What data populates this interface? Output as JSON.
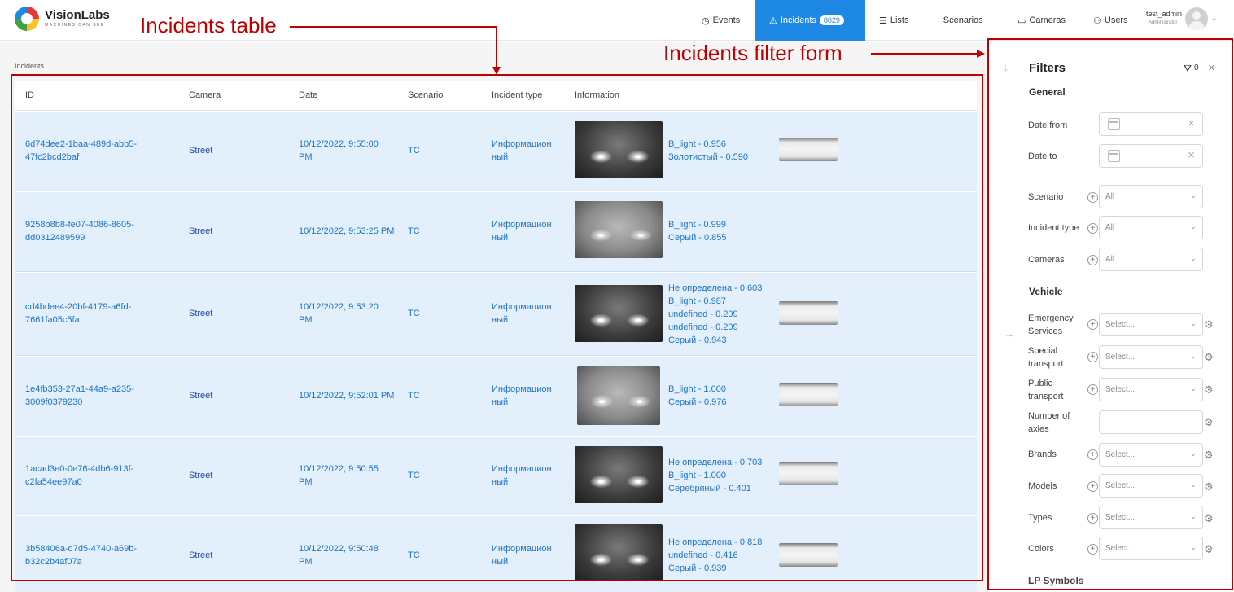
{
  "app": {
    "logo_title": "VisionLabs",
    "logo_sub": "MACHINES CAN SEE"
  },
  "nav": {
    "events": "Events",
    "incidents": "Incidents",
    "incidents_count": "8029",
    "lists": "Lists",
    "scenarios": "Scenarios",
    "cameras": "Cameras",
    "users": "Users"
  },
  "user": {
    "name": "test_admin",
    "role": "Administrator"
  },
  "page": {
    "breadcrumb": "Incidents"
  },
  "table": {
    "headers": {
      "id": "ID",
      "camera": "Camera",
      "date": "Date",
      "scenario": "Scenario",
      "type": "Incident type",
      "info": "Information"
    },
    "rows": [
      {
        "id1": "6d74dee2-1baa-489d-abb5-",
        "id2": "47fc2bcd2baf",
        "camera": "Street",
        "date1": "10/12/2022, 9:55:00",
        "date2": "PM",
        "scenario": "TC",
        "type1": "Информацион",
        "type2": "ный",
        "info": [
          "B_light - 0.956",
          "Золотистый - 0.590"
        ]
      },
      {
        "id1": "9258b8b8-fe07-4086-8605-",
        "id2": "dd0312489599",
        "camera": "Street",
        "date1": "10/12/2022, 9:53:25 PM",
        "date2": "",
        "scenario": "TC",
        "type1": "Информацион",
        "type2": "ный",
        "info": [
          "B_light - 0.999",
          "Серый - 0.855"
        ]
      },
      {
        "id1": "cd4bdee4-20bf-4179-a6fd-",
        "id2": "7661fa05c5fa",
        "camera": "Street",
        "date1": "10/12/2022, 9:53:20",
        "date2": "PM",
        "scenario": "TC",
        "type1": "Информацион",
        "type2": "ный",
        "info": [
          "Не определена - 0.603",
          "B_light - 0.987",
          "undefined - 0.209",
          "undefined - 0.209",
          "Серый - 0.943"
        ]
      },
      {
        "id1": "1e4fb353-27a1-44a9-a235-",
        "id2": "3009f0379230",
        "camera": "Street",
        "date1": "10/12/2022, 9:52:01 PM",
        "date2": "",
        "scenario": "TC",
        "type1": "Информацион",
        "type2": "ный",
        "info": [
          "B_light - 1.000",
          "Серый - 0.976"
        ]
      },
      {
        "id1": "1acad3e0-0e76-4db6-913f-",
        "id2": "c2fa54ee97a0",
        "camera": "Street",
        "date1": "10/12/2022, 9:50:55",
        "date2": "PM",
        "scenario": "TC",
        "type1": "Информацион",
        "type2": "ный",
        "info": [
          "Не определена - 0.703",
          "B_light - 1.000",
          "Серебряный - 0.401"
        ]
      },
      {
        "id1": "3b58406a-d7d5-4740-a69b-",
        "id2": "b32c2b4af07a",
        "camera": "Street",
        "date1": "10/12/2022, 9:50:48",
        "date2": "PM",
        "scenario": "TC",
        "type1": "Информацион",
        "type2": "ный",
        "info": [
          "Не определена - 0.818",
          "undefined - 0.416",
          "Серый - 0.939"
        ]
      }
    ]
  },
  "filters": {
    "title": "Filters",
    "active_count": "0",
    "general_title": "General",
    "date_from": "Date from",
    "date_to": "Date to",
    "scenario": "Scenario",
    "incident_type": "Incident type",
    "cameras": "Cameras",
    "all_value": "All",
    "vehicle_title": "Vehicle",
    "emergency_1": "Emergency",
    "emergency_2": "Services",
    "special_1": "Special",
    "special_2": "transport",
    "public_1": "Public",
    "public_2": "transport",
    "axles_1": "Number of",
    "axles_2": "axles",
    "brands": "Brands",
    "models": "Models",
    "types": "Types",
    "colors": "Colors",
    "select_placeholder": "Select...",
    "lp_symbols": "LP Symbols"
  },
  "annotations": {
    "table_label": "Incidents table",
    "filter_label": "Incidents filter form",
    "color": "#c00000"
  }
}
